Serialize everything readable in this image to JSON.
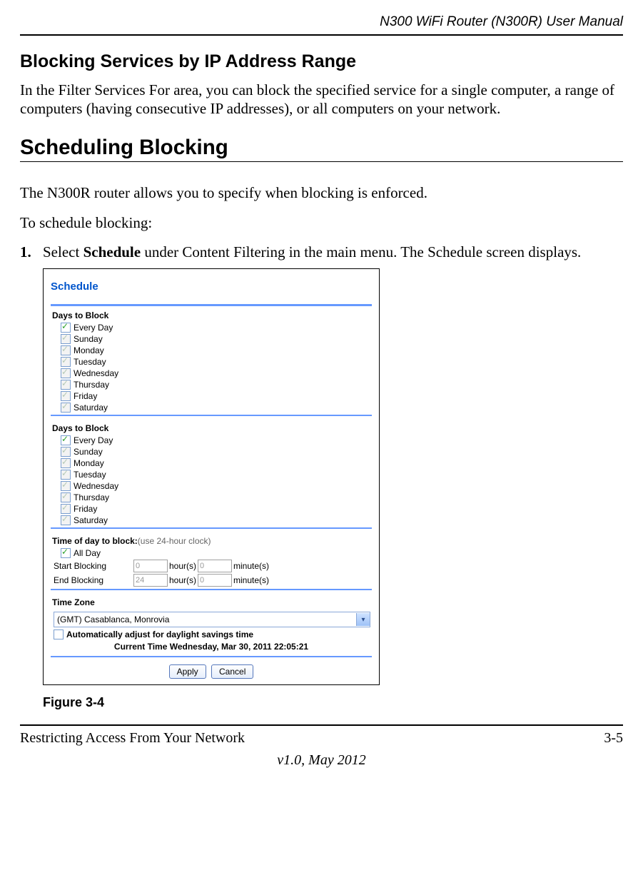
{
  "header": {
    "manual_title": "N300 WiFi Router (N300R) User Manual"
  },
  "section1": {
    "heading": "Blocking Services by IP Address Range",
    "para": "In the Filter Services For area, you can block the specified service for a single computer, a range of computers (having consecutive IP addresses), or all computers on your network."
  },
  "section2": {
    "heading": "Scheduling Blocking",
    "para1": "The N300R router allows you to specify when blocking is enforced.",
    "para2": "To schedule blocking:",
    "step1_num": "1.",
    "step1_pre": "Select ",
    "step1_bold": "Schedule",
    "step1_post": " under Content Filtering in the main menu. The Schedule screen displays."
  },
  "screenshot": {
    "title": "Schedule",
    "days_label": "Days to Block",
    "days": [
      "Every Day",
      "Sunday",
      "Monday",
      "Tuesday",
      "Wednesday",
      "Thursday",
      "Friday",
      "Saturday"
    ],
    "time_label": "Time of day to block:",
    "time_hint": "(use 24-hour clock)",
    "all_day": "All Day",
    "start_label": "Start Blocking",
    "end_label": "End Blocking",
    "hours": "hour(s)",
    "minutes": "minute(s)",
    "start_h": "0",
    "start_m": "0",
    "end_h": "24",
    "end_m": "0",
    "tz_label": "Time Zone",
    "tz_value": "(GMT) Casablanca, Monrovia",
    "dst": "Automatically adjust for daylight savings time",
    "current_time": "Current Time Wednesday, Mar 30, 2011 22:05:21",
    "apply": "Apply",
    "cancel": "Cancel"
  },
  "figure_caption": "Figure 3-4",
  "footer": {
    "left": "Restricting Access From Your Network",
    "right": "3-5",
    "version": "v1.0, May 2012"
  }
}
